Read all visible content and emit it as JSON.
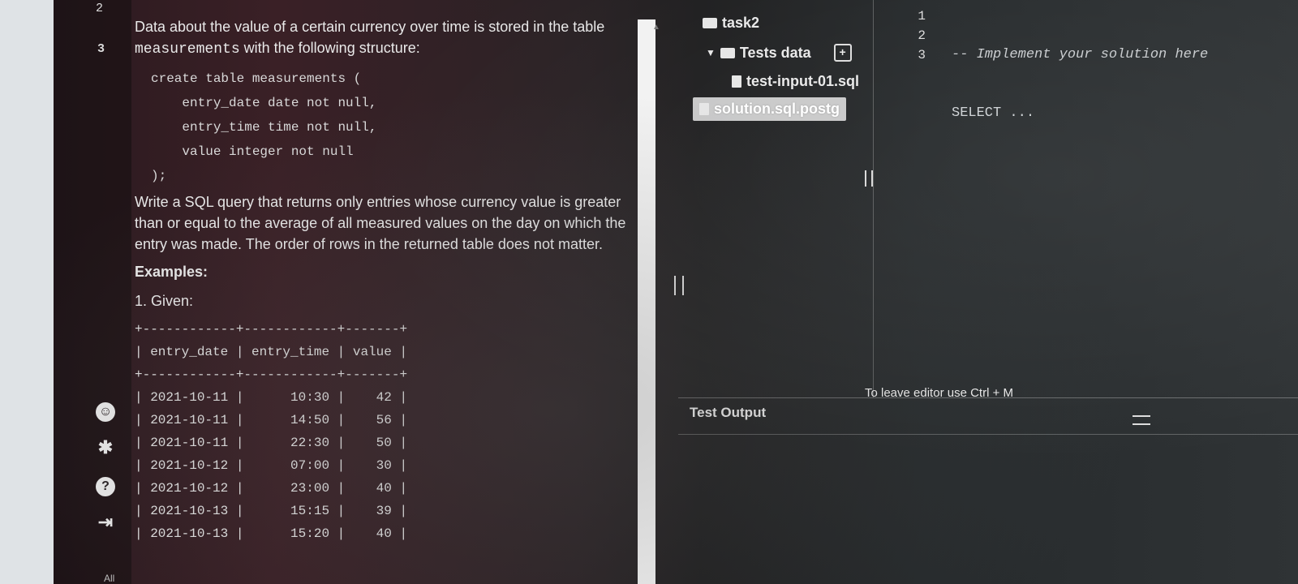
{
  "gutter_left": {
    "line_a": "2",
    "line_b": "3"
  },
  "problem": {
    "intro_1": "Data about the value of a certain currency over time is stored in the table",
    "table_name": "measurements",
    "intro_2": " with the following structure:",
    "schema": "create table measurements (\n    entry_date date not null,\n    entry_time time not null,\n    value integer not null\n);",
    "task": "Write a SQL query that returns only entries whose currency value is greater than or equal to the average of all measured values on the day on which the entry was made. The order of rows in the returned table does not matter.",
    "examples_heading": "Examples:",
    "example_1_label": "1. Given:",
    "example_table": "+------------+------------+-------+\n| entry_date | entry_time | value |\n+------------+------------+-------+\n| 2021-10-11 |      10:30 |    42 |\n| 2021-10-11 |      14:50 |    56 |\n| 2021-10-11 |      22:30 |    50 |\n| 2021-10-12 |      07:00 |    30 |\n| 2021-10-12 |      23:00 |    40 |\n| 2021-10-13 |      15:15 |    39 |\n| 2021-10-13 |      15:20 |    40 |",
    "footer_text": "All chang"
  },
  "file_tree": {
    "root": "task2",
    "tests_folder": "Tests data",
    "test_file": "test-input-01.sql",
    "selected_file": "solution.sql.postg"
  },
  "editor": {
    "line_numbers": [
      "1",
      "2",
      "3"
    ],
    "line_1": "-- Implement your solution here",
    "line_2": "SELECT ...",
    "hint": "To leave editor use Ctrl + M"
  },
  "output": {
    "title": "Test Output"
  },
  "icons": [
    "accessibility-icon",
    "settings-icon",
    "help-icon",
    "logout-icon",
    "folder-icon",
    "file-icon",
    "add-file-icon"
  ]
}
